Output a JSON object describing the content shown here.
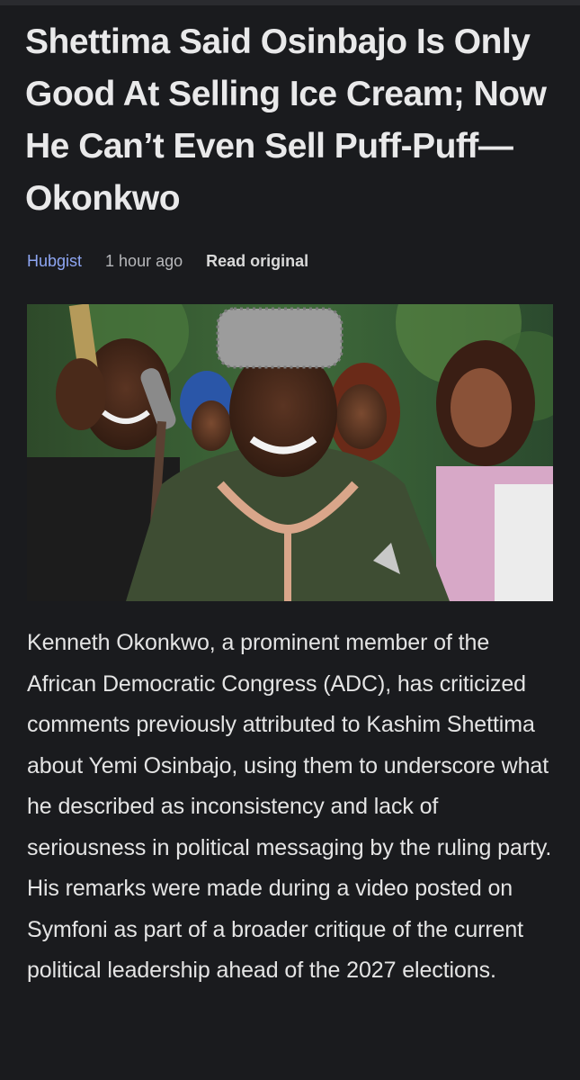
{
  "article": {
    "title": "Shettima Said Osinbajo Is Only Good At Selling Ice Cream; Now He Can’t Even Sell Puff-Puff—Okonkwo",
    "source": "Hubgist",
    "time_ago": "1 hour ago",
    "read_original_label": "Read original",
    "body": "Kenneth Okonkwo, a prominent member of the African Democratic Congress (ADC), has criticized comments previously attributed to Kashim Shettima about Yemi Osinbajo, using them to underscore what he described as inconsistency and lack of seriousness in political messaging by the ruling party. His remarks were made during a video posted on Symfoni as part of a broader critique of the current political leadership ahead of the 2027 elections."
  },
  "colors": {
    "background": "#1a1b1e",
    "text": "#e4e4e4",
    "source_link": "#8ea6f3",
    "muted": "#b7b8bb"
  }
}
